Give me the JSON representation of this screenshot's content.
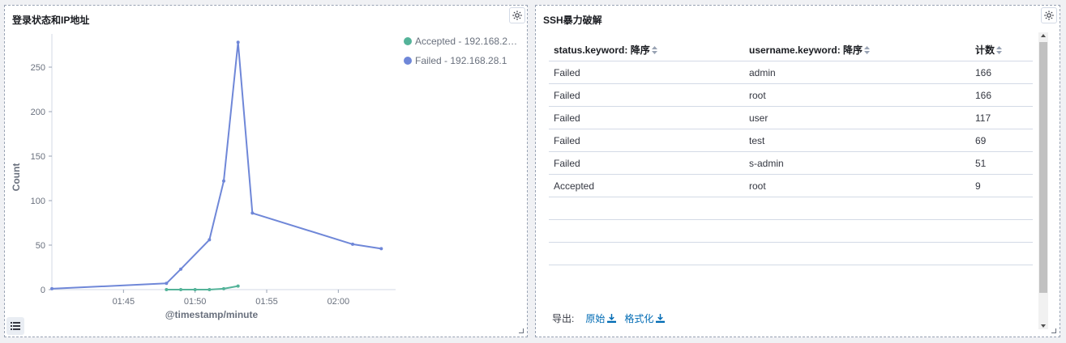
{
  "left_panel": {
    "title": "登录状态和IP地址",
    "legend": [
      {
        "label": "Accepted - 192.168.2…",
        "color": "#54b399"
      },
      {
        "label": "Failed - 192.168.28.1",
        "color": "#6092c0"
      }
    ],
    "chart_data": {
      "type": "line",
      "xlabel": "@timestamp/minute",
      "ylabel": "Count",
      "x_ticks": [
        "01:45",
        "01:50",
        "01:55",
        "02:00"
      ],
      "y_ticks": [
        0,
        50,
        100,
        150,
        200,
        250
      ],
      "ylim": [
        0,
        280
      ],
      "series": [
        {
          "name": "Failed - 192.168.28.1",
          "color": "#6f87d8",
          "points": [
            [
              "01:40",
              1
            ],
            [
              "01:48",
              7
            ],
            [
              "01:49",
              23
            ],
            [
              "01:51",
              56
            ],
            [
              "01:52",
              122
            ],
            [
              "01:53",
              278
            ],
            [
              "01:54",
              86
            ],
            [
              "02:01",
              51
            ],
            [
              "02:03",
              46
            ]
          ]
        },
        {
          "name": "Accepted - 192.168.2…",
          "color": "#54b399",
          "points": [
            [
              "01:48",
              0
            ],
            [
              "01:49",
              0
            ],
            [
              "01:50",
              0
            ],
            [
              "01:51",
              0
            ],
            [
              "01:52",
              1
            ],
            [
              "01:53",
              4
            ]
          ]
        }
      ]
    }
  },
  "right_panel": {
    "title": "SSH暴力破解",
    "columns": [
      "status.keyword: 降序",
      "username.keyword: 降序",
      "计数"
    ],
    "rows": [
      [
        "Failed",
        "admin",
        "166"
      ],
      [
        "Failed",
        "root",
        "166"
      ],
      [
        "Failed",
        "user",
        "117"
      ],
      [
        "Failed",
        "test",
        "69"
      ],
      [
        "Failed",
        "s-admin",
        "51"
      ],
      [
        "Accepted",
        "root",
        "9"
      ]
    ],
    "export_label": "导出:",
    "export_raw": "原始",
    "export_formatted": "格式化"
  }
}
